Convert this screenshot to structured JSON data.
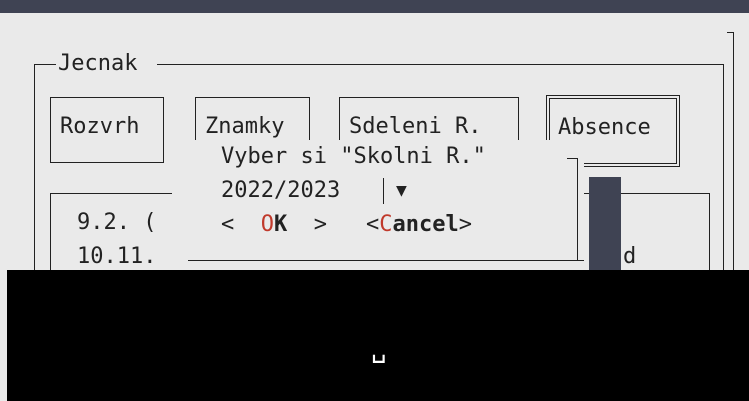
{
  "frame_title": "Jecnak",
  "tabs": [
    {
      "label": "Rozvrh"
    },
    {
      "label": "Znamky"
    },
    {
      "label": "Sdeleni R."
    },
    {
      "label": "Absence",
      "selected": true
    }
  ],
  "list": {
    "row1": "9.2. (",
    "row2": "10.11.",
    "row2_tail": "d"
  },
  "dialog": {
    "title": "Vyber si \"Skolni R.\"",
    "selected_value": "2022/2023",
    "dropdown_arrow": "▼",
    "ok_prefix": "O",
    "ok_rest": "K",
    "ok_open": "<",
    "ok_close": ">",
    "cancel_open": "<",
    "cancel_hotkey": "C",
    "cancel_rest": "ancel",
    "cancel_close": ">"
  },
  "cursor_glyph": "␣",
  "colors": {
    "titlebar": "#3f4353",
    "background": "#eaeaea",
    "hotkey": "#c0392b",
    "terminal_bottom": "#000000"
  }
}
